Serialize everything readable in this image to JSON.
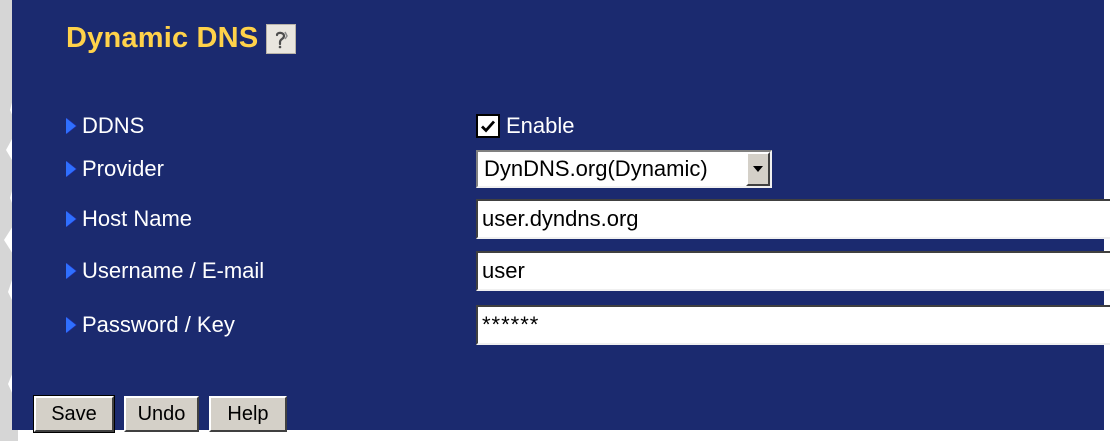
{
  "page": {
    "title": "Dynamic DNS"
  },
  "fields": {
    "ddns": {
      "label": "DDNS",
      "checkbox_label": "Enable",
      "checked": true
    },
    "provider": {
      "label": "Provider",
      "selected": "DynDNS.org(Dynamic)"
    },
    "host_name": {
      "label": "Host Name",
      "value": "user.dyndns.org"
    },
    "username": {
      "label": "Username / E-mail",
      "value": "user"
    },
    "password": {
      "label": "Password / Key",
      "value": "******"
    }
  },
  "buttons": {
    "save": "Save",
    "undo": "Undo",
    "help": "Help"
  },
  "colors": {
    "panel_background": "#1b2a6f",
    "title": "#ffd24a",
    "label_text": "#ffffff",
    "bullet": "#2f6fff",
    "button_face": "#d4d0c8"
  },
  "icons": {
    "title_help": "help-icon",
    "row_bullet": "triangle-bullet-icon",
    "select_arrow": "chevron-down-icon",
    "checkbox_mark": "checkmark-icon"
  }
}
